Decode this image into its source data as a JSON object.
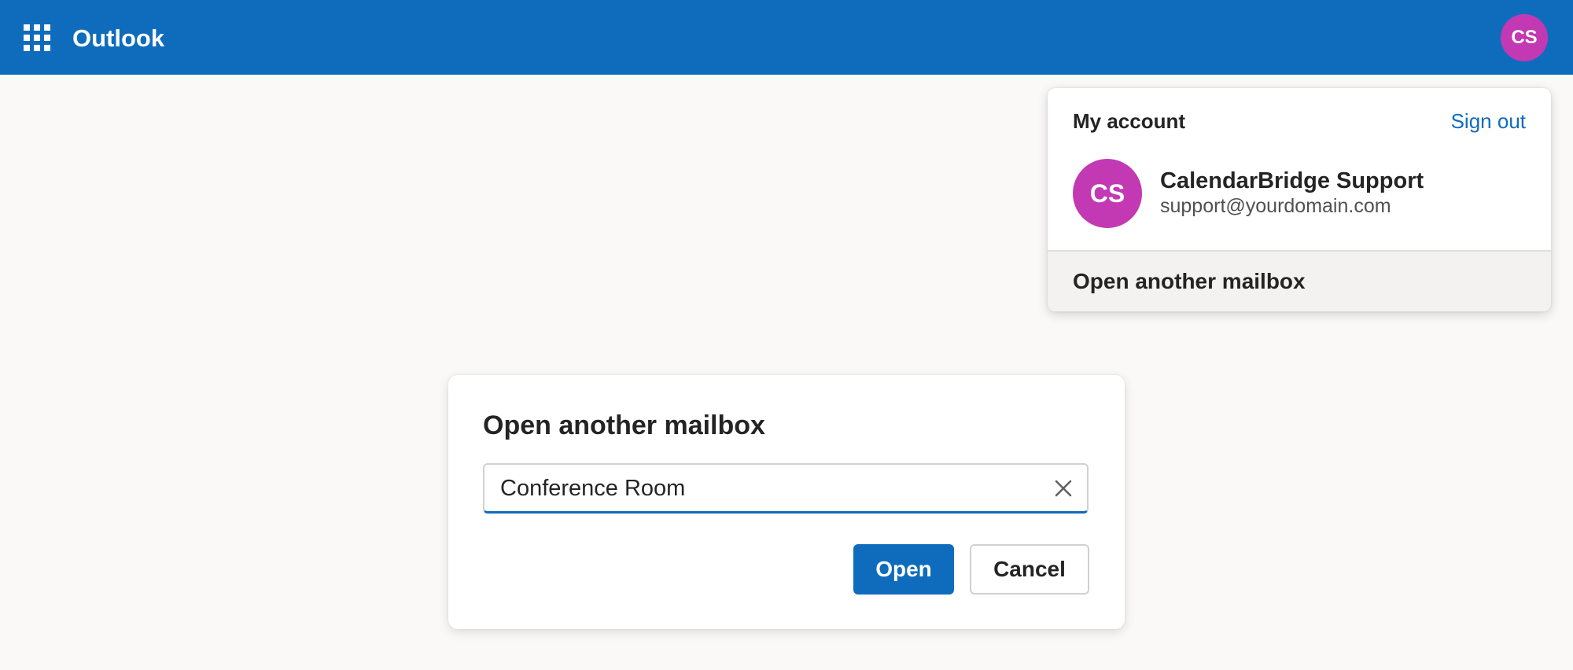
{
  "header": {
    "app_title": "Outlook",
    "apps_icon": "app-launcher-waffle-icon",
    "user_initials": "CS",
    "background_color": "#0f6cbd"
  },
  "account_panel": {
    "heading": "My account",
    "sign_out_label": "Sign out",
    "user_initials": "CS",
    "user_name": "CalendarBridge Support",
    "user_email": "support@yourdomain.com",
    "avatar_color": "#c239b3",
    "action_label": "Open another mailbox"
  },
  "dialog": {
    "title": "Open another mailbox",
    "input_value": "Conference Room",
    "clear_icon": "close-icon",
    "open_label": "Open",
    "cancel_label": "Cancel",
    "accent_color": "#0f6cbd"
  }
}
